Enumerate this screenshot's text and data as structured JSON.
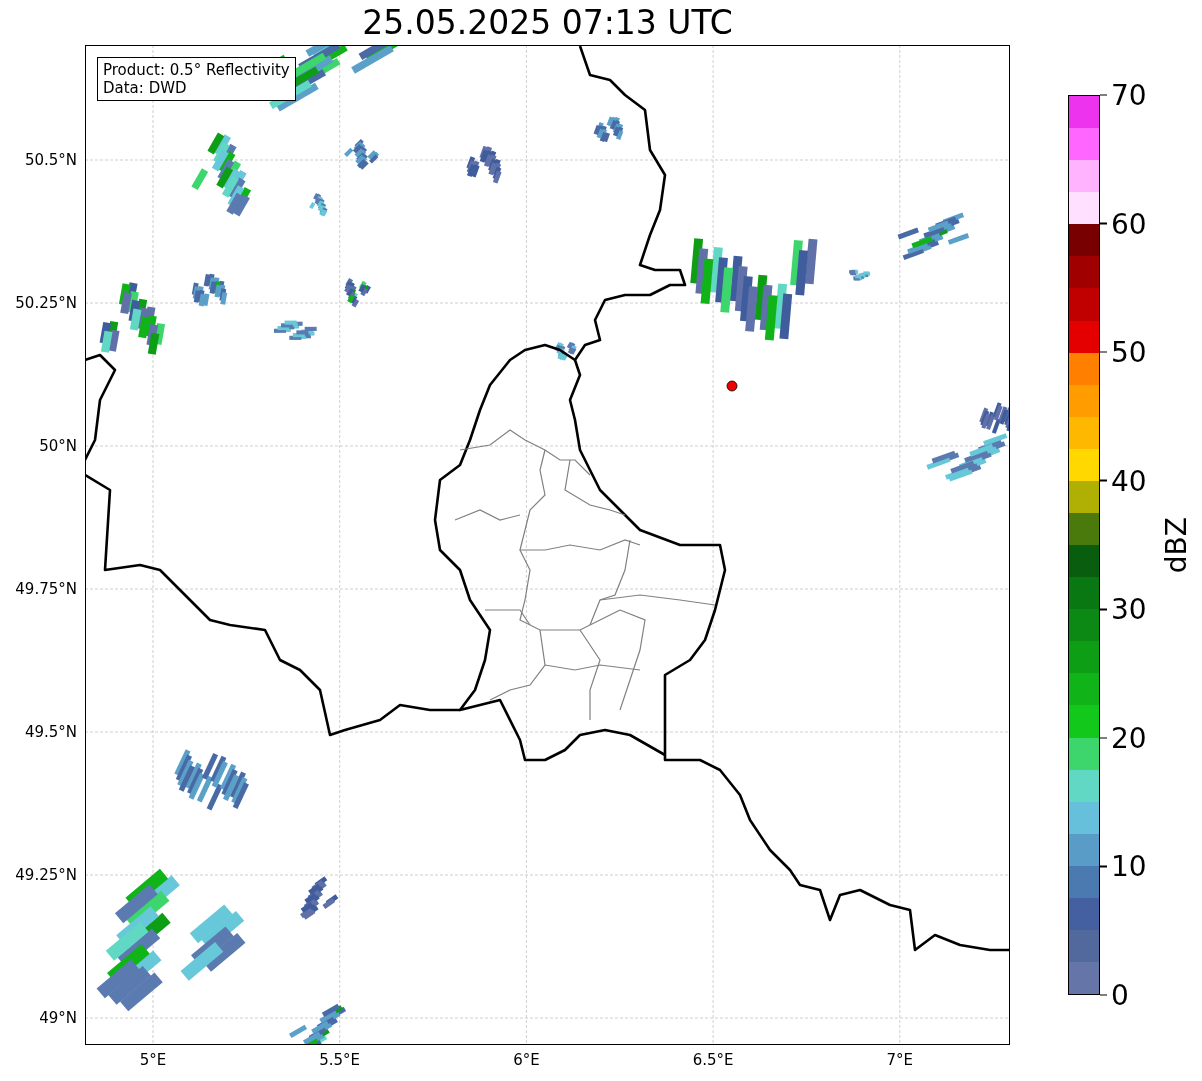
{
  "title": "25.05.2025 07:13 UTC",
  "info_box": {
    "lines": [
      "Product: 0.5° Reflectivity",
      "Data: DWD"
    ]
  },
  "map": {
    "y_ticks": [
      "50.5°N",
      "50.25°N",
      "50°N",
      "49.75°N",
      "49.5°N",
      "49.25°N",
      "49°N"
    ],
    "x_ticks": [
      "5°E",
      "5.5°E",
      "6°E",
      "6.5°E",
      "7°E"
    ]
  },
  "colorbar": {
    "label": "dBZ",
    "ticks": [
      "70",
      "60",
      "50",
      "40",
      "30",
      "20",
      "10",
      "0"
    ],
    "segments": [
      {
        "color": "#ee33ee"
      },
      {
        "color": "#ff66ff"
      },
      {
        "color": "#ffb3ff"
      },
      {
        "color": "#ffe0ff"
      },
      {
        "color": "#780000"
      },
      {
        "color": "#a00000"
      },
      {
        "color": "#c00000"
      },
      {
        "color": "#e40000"
      },
      {
        "color": "#ff8000"
      },
      {
        "color": "#ff9c00"
      },
      {
        "color": "#ffb800"
      },
      {
        "color": "#ffd800"
      },
      {
        "color": "#b0b004"
      },
      {
        "color": "#4a7a0c"
      },
      {
        "color": "#085e0e"
      },
      {
        "color": "#0a7812"
      },
      {
        "color": "#0c8814"
      },
      {
        "color": "#0e9e16"
      },
      {
        "color": "#10b418"
      },
      {
        "color": "#12c81a"
      },
      {
        "color": "#3cd66c"
      },
      {
        "color": "#60d8c4"
      },
      {
        "color": "#66c0dc"
      },
      {
        "color": "#5a9cc8"
      },
      {
        "color": "#4a7ab0"
      },
      {
        "color": "#4560a0"
      },
      {
        "color": "#52699e"
      },
      {
        "color": "#6675a8"
      }
    ]
  }
}
